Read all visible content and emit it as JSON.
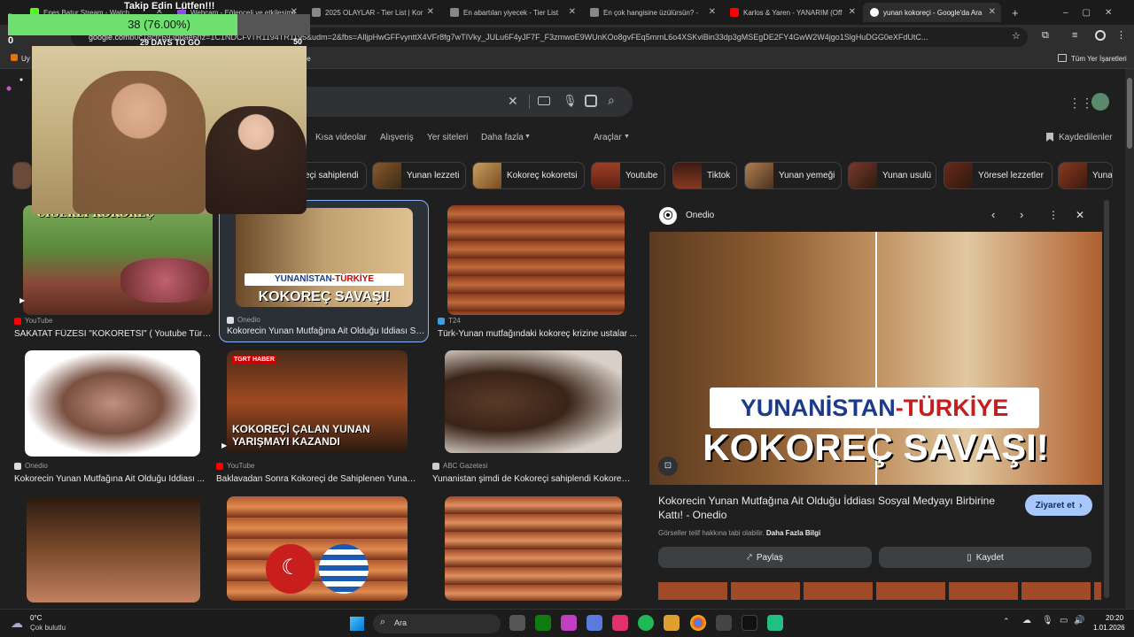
{
  "tabs": [
    {
      "label": "Enes Batur Stream - Watch",
      "color": "#53fc18"
    },
    {
      "label": "Webcam - Eğlenceli ve etkileşimli",
      "color": "#9146ff"
    },
    {
      "label": "2025 OLAYLAR - Tier List | Kor",
      "color": "#888888"
    },
    {
      "label": "En abartılan yiyecek - Tier List",
      "color": "#888888"
    },
    {
      "label": "En çok hangisine üzülürsün? -",
      "color": "#888888"
    },
    {
      "label": "Karlos & Yaren - YANARIM (Off",
      "color": "#ff0000"
    },
    {
      "label": "yunan kokoreçi - Google'da Ara",
      "color": "#4285f4"
    }
  ],
  "new_tab": "+",
  "overlay": {
    "title": "Takip Edin Lütfen!!!",
    "progress_text": "38 (76.00%)",
    "progress": 0.76,
    "left_num": "0",
    "days": "29 DAYS TO GO",
    "right_num": "50"
  },
  "url": {
    "host": "google.com",
    "path": "b0c18cfc693bbae6rlz=1C1NDCFvTR1194TR1195&udm=2&fbs=AIljpHwGFFvynttX4VFr8fg7wTIVky_JULu6F4yJF7F_F3zmwoE9WUnKOo8gvFEq5mrnL6o4XSKviBin33dp3gMSEgDE2FY4GwW2W4jgo1SlgHuDGG0eXFdUtC..."
  },
  "bookmarks": {
    "left": "Uy",
    "mid": "gle",
    "right": "Tüm Yer İşaretleri"
  },
  "nav": {
    "videos": "Kısa videolar",
    "shopping": "Alışveriş",
    "web": "Yer siteleri",
    "more": "Daha fazla",
    "tools": "Araçlar",
    "saved": "Kaydedilenler"
  },
  "chips": [
    "eçi sahiplendi",
    "Yunan lezzeti",
    "Kokoreç kokoretsi",
    "Youtube",
    "Tiktok",
    "Yunan yemeği",
    "Yunan usulü",
    "Yöresel lezzetler",
    "Yuna"
  ],
  "results": [
    {
      "source": "YouTube",
      "title": "SAKATAT FÜZESİ \"KOKORETSI\" ( Youtube Türki...",
      "overlay": "CİĞERLİ KOKOREÇ"
    },
    {
      "source": "Onedio",
      "title": "Kokorecin Yunan Mutfağına Ait Olduğu İddiası So...",
      "overlay": "YUNANİSTAN-TÜRKİYE KOKOREÇ SAVAŞI!"
    },
    {
      "source": "T24",
      "title": "Türk-Yunan mutfağındaki kokoreç krizine ustalar ...",
      "overlay": ""
    },
    {
      "source": "Onedio",
      "title": "Kokorecin Yunan Mutfağına Ait Olduğu İddiası ...",
      "overlay": ""
    },
    {
      "source": "YouTube",
      "title": "Baklavadan Sonra Kokoreçi de Sahiplenen Yunani...",
      "overlay": "KOKOREÇİ ÇALAN YUNAN YARIŞMAYI KAZANDI"
    },
    {
      "source": "ABC Gazetesi",
      "title": "Yunanistan şimdi de Kokoreçi sahiplendi Kokoretsi...",
      "overlay": ""
    },
    {
      "source": "",
      "title": "",
      "overlay": ""
    },
    {
      "source": "",
      "title": "",
      "overlay": ""
    },
    {
      "source": "",
      "title": "",
      "overlay": ""
    }
  ],
  "tgrt": "TGRT HABER",
  "panel": {
    "source": "Onedio",
    "image_line1a": "YUNANİSTAN",
    "image_line1b": "-TÜRKİYE",
    "image_line2": "KOKOREÇ SAVAŞI!",
    "title": "Kokorecin Yunan Mutfağına Ait Olduğu İddiası Sosyal Medyayı Birbirine Kattı! - Onedio",
    "visit": "Ziyaret et",
    "copyright": "Görseller telif hakkına tabi olabilir.",
    "more_info": "Daha Fazla Bilgi",
    "share": "Paylaş",
    "save": "Kaydet"
  },
  "taskbar": {
    "temp": "0°C",
    "weather": "Çok bulutlu",
    "search": "Ara",
    "time": "20:20",
    "date": "1.01.2026"
  }
}
